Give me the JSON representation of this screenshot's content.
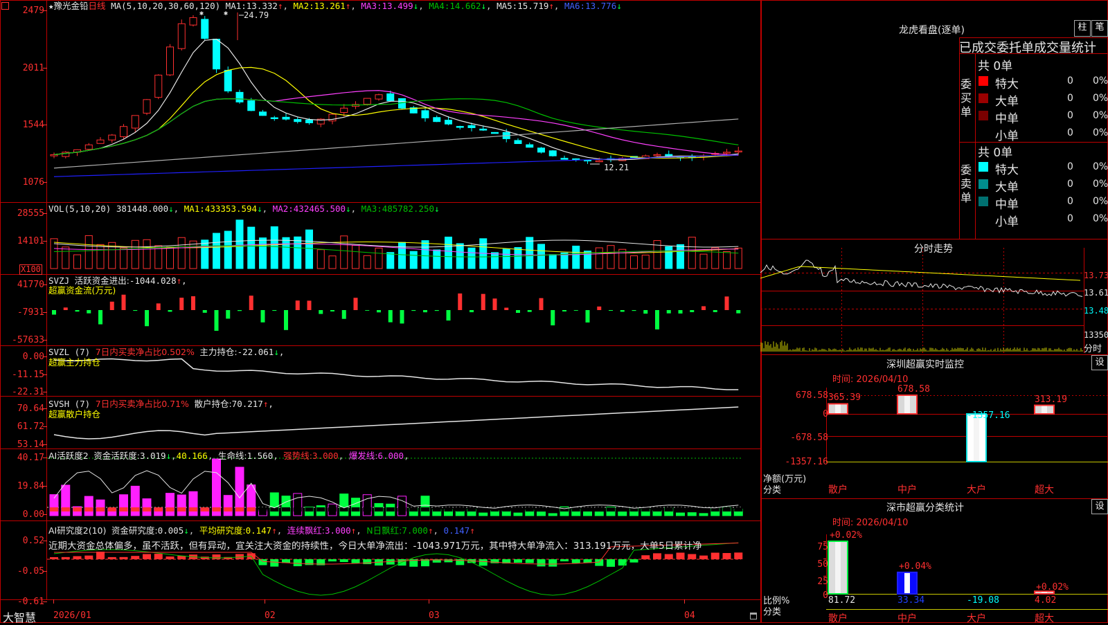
{
  "app": {
    "brand": "大智慧",
    "corner_icon": "window-icon",
    "lock_icon": "lock-icon"
  },
  "colors": {
    "up": "#ff3030",
    "down": "#00ffff",
    "bg": "#000000",
    "grid": "#c00000",
    "ma1": "#e6e6e6",
    "ma2": "#ffff00",
    "ma3": "#ff40ff",
    "ma4": "#00c000",
    "ma5": "#b0b0b0",
    "ma6": "#2020ff"
  },
  "main": {
    "star": "★",
    "name": "豫光金铅",
    "period": "日线",
    "ma_label": "MA(5,10,20,30,60,120)",
    "ma": [
      {
        "label": "MA1:",
        "value": "13.332",
        "arrow": "↑"
      },
      {
        "label": "MA2:",
        "value": "13.261",
        "arrow": "↑"
      },
      {
        "label": "MA3:",
        "value": "13.499",
        "arrow": "↓"
      },
      {
        "label": "MA4:",
        "value": "14.662",
        "arrow": "↓"
      },
      {
        "label": "MA5:",
        "value": "15.719",
        "arrow": "↑"
      },
      {
        "label": "MA6:",
        "value": "13.776",
        "arrow": "↓"
      }
    ],
    "yticks": [
      "2479",
      "2011",
      "1544",
      "1076"
    ],
    "high_label": "24.79",
    "low_label": "12.21"
  },
  "vol": {
    "label": "VOL(5,10,20)",
    "value": "381448.000",
    "value_arrow": "↓",
    "ma": [
      {
        "label": "MA1:",
        "value": "433353.594",
        "arrow": "↓"
      },
      {
        "label": "MA2:",
        "value": "432465.500",
        "arrow": "↓"
      },
      {
        "label": "MA3:",
        "value": "485782.250",
        "arrow": "↓"
      }
    ],
    "yticks": [
      "28555",
      "14101"
    ],
    "unit": "X100"
  },
  "svzj": {
    "label": "SVZJ",
    "desc": "活跃资金进出:",
    "value": "-1044.028",
    "arrow": "↑",
    "suffix": ",",
    "sub": "超赢资金流(万元)",
    "yticks": [
      "41770",
      "-7931",
      "-57633"
    ]
  },
  "svzl": {
    "label": "SVZL (7)",
    "desc": "7日内买卖净占比0.502%",
    "desc2": "主力持仓:",
    "value": "-22.061",
    "arrow": "↓",
    "suffix": ",",
    "sub": "超赢主力持仓",
    "yticks": [
      "0.00",
      "-11.15",
      "-22.31"
    ]
  },
  "svsh": {
    "label": "SVSH (7)",
    "desc": "7日内买卖净占比0.71%",
    "desc2": "散户持仓:",
    "value": "70.217",
    "arrow": "↑",
    "suffix": ",",
    "sub": "超赢散户持仓",
    "yticks": [
      "70.64",
      "61.72",
      "53.14"
    ]
  },
  "ai1": {
    "label": "AI活跃度2",
    "desc": "资金活跃度:",
    "value": "3.019",
    "arrow": "↓",
    "value2": "40.166",
    "life_label": "生命线:",
    "life": "1.560",
    "strong_label": "强势线:",
    "strong": "3.000",
    "burst_label": "爆发线:",
    "burst": "6.000",
    "yticks": [
      "40.17",
      "19.84",
      "0.00"
    ]
  },
  "ai2": {
    "label": "AI研究度2(10)",
    "desc": "资金研究度:",
    "value": "0.005",
    "arrow": "↓",
    "avg_label": "平均研究度:",
    "avg": "0.147",
    "avg_arrow": "↑",
    "cons_label": "连续飘红:",
    "cons": "3.000",
    "cons_arrow": "↑",
    "nday_label": "N日飘红:",
    "nday": "7.000",
    "nday_arrow": "↑",
    "last": "0.147",
    "last_arrow": "↑",
    "comment": "近期大资金总体偏多，虽不活跃，但有异动，宜关注大资金的持续性，今日大单净流出：-1043.971万元，其中特大单净流入：313.191万元，大单5日累计净",
    "yticks": [
      "0.52",
      "-0.05",
      "-0.61"
    ]
  },
  "xaxis": [
    "2026/01",
    "02",
    "03",
    "04"
  ],
  "panel_dragon": {
    "title": "龙虎看盘(逐单)",
    "btn_bar": "柱",
    "btn_order": "笔",
    "tabs": "已成交委托单成交量统计",
    "buy_label": "委买单",
    "sell_label": "委卖单",
    "buy_total": "共 0单",
    "sell_total": "共 0单",
    "buy_rows": [
      {
        "name": "特大",
        "count": "0",
        "pct": "0%",
        "color": "#ff0000"
      },
      {
        "name": "大单",
        "count": "0",
        "pct": "0%",
        "color": "#9a0000"
      },
      {
        "name": "中单",
        "count": "0",
        "pct": "0%",
        "color": "#7a0000"
      },
      {
        "name": "小单",
        "count": "0",
        "pct": "0%",
        "color": "#000000"
      }
    ],
    "sell_rows": [
      {
        "name": "特大",
        "count": "0",
        "pct": "0%",
        "color": "#00ffff"
      },
      {
        "name": "大单",
        "count": "0",
        "pct": "0%",
        "color": "#008c8c"
      },
      {
        "name": "中单",
        "count": "0",
        "pct": "0%",
        "color": "#007070"
      },
      {
        "name": "小单",
        "count": "0",
        "pct": "0%",
        "color": "#000000"
      }
    ]
  },
  "panel_intraday": {
    "title": "分时走势",
    "yticks": [
      "13.73",
      "13.61",
      "13.48"
    ],
    "vol_tick": "13350",
    "footer": "分时"
  },
  "panel_monitor": {
    "title": "深圳超赢实时监控",
    "btn": "设",
    "time": "时间: 2026/04/10",
    "yticks": [
      "678.58",
      "0",
      "-678.58",
      "-1357.16"
    ],
    "ylabel": "净额(万元)",
    "xlabel": "分类",
    "chart_data": {
      "type": "bar",
      "categories": [
        "散户",
        "中户",
        "大户",
        "超大"
      ],
      "values": [
        365.39,
        678.58,
        -1357.16,
        313.19
      ],
      "ylim": [
        -1357.16,
        678.58
      ],
      "value_labels": [
        "365.39",
        "678.58",
        "-1357.16",
        "313.19"
      ]
    }
  },
  "panel_class": {
    "title": "深市超赢分类统计",
    "btn": "设",
    "time": "时间: 2026/04/10",
    "yticks": [
      "75",
      "50",
      "25",
      "0"
    ],
    "ylabel": "比例%",
    "xlabel": "分类",
    "chart_data": {
      "type": "bar",
      "categories": [
        "散户",
        "中户",
        "大户",
        "超大"
      ],
      "top_labels": [
        "+0.02%",
        "+0.04%",
        "",
        "+0.02%"
      ],
      "values": [
        81.72,
        33.34,
        -19.08,
        4.02
      ],
      "value_labels": [
        "81.72",
        "33.34",
        "-19.08",
        "4.02"
      ],
      "ylim": [
        0,
        75
      ]
    }
  }
}
